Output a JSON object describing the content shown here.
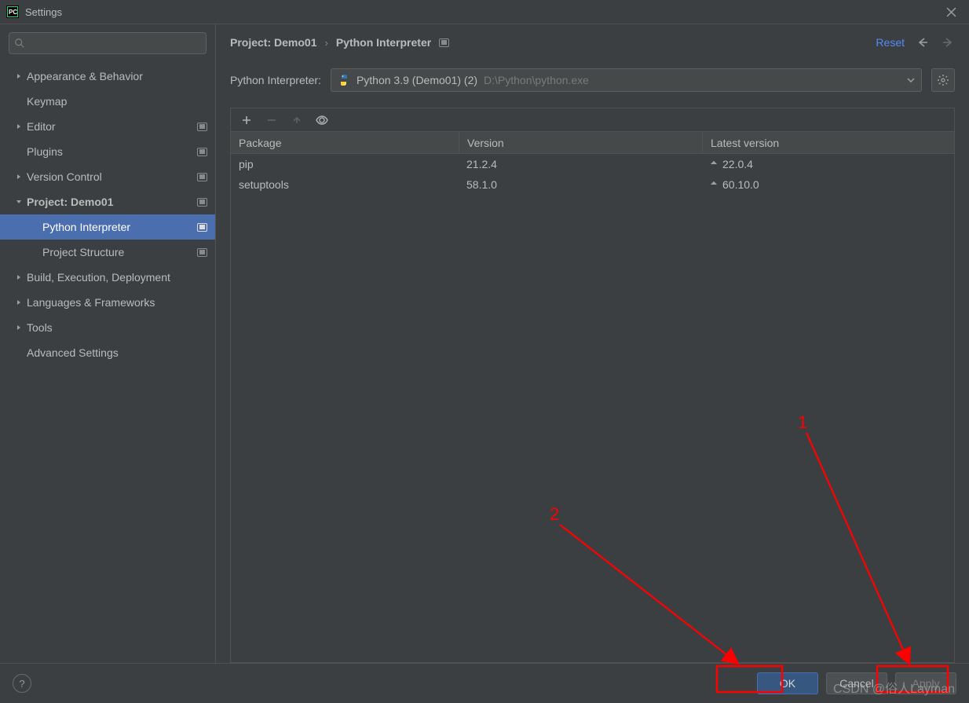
{
  "window": {
    "title": "Settings"
  },
  "sidebar": {
    "items": [
      {
        "label": "Appearance & Behavior",
        "expandable": true,
        "badge": false
      },
      {
        "label": "Keymap",
        "expandable": false,
        "badge": false
      },
      {
        "label": "Editor",
        "expandable": true,
        "badge": true
      },
      {
        "label": "Plugins",
        "expandable": false,
        "badge": true
      },
      {
        "label": "Version Control",
        "expandable": true,
        "badge": true
      },
      {
        "label": "Project: Demo01",
        "expandable": true,
        "expanded": true,
        "bold": true,
        "badge": true,
        "children": [
          {
            "label": "Python Interpreter",
            "badge": true,
            "selected": true
          },
          {
            "label": "Project Structure",
            "badge": true
          }
        ]
      },
      {
        "label": "Build, Execution, Deployment",
        "expandable": true
      },
      {
        "label": "Languages & Frameworks",
        "expandable": true
      },
      {
        "label": "Tools",
        "expandable": true
      },
      {
        "label": "Advanced Settings",
        "expandable": false
      }
    ]
  },
  "breadcrumb": {
    "project": "Project: Demo01",
    "page": "Python Interpreter"
  },
  "header": {
    "reset": "Reset"
  },
  "interpreter": {
    "label": "Python Interpreter:",
    "name": "Python 3.9 (Demo01) (2)",
    "path": "D:\\Python\\python.exe"
  },
  "packages": {
    "columns": {
      "package": "Package",
      "version": "Version",
      "latest": "Latest version"
    },
    "rows": [
      {
        "name": "pip",
        "version": "21.2.4",
        "latest": "22.0.4",
        "upgradable": true
      },
      {
        "name": "setuptools",
        "version": "58.1.0",
        "latest": "60.10.0",
        "upgradable": true
      }
    ]
  },
  "footer": {
    "ok": "OK",
    "cancel": "Cancel",
    "apply": "Apply"
  },
  "annotations": {
    "label1": "1",
    "label2": "2"
  },
  "watermark": "CSDN @俗人Layman"
}
